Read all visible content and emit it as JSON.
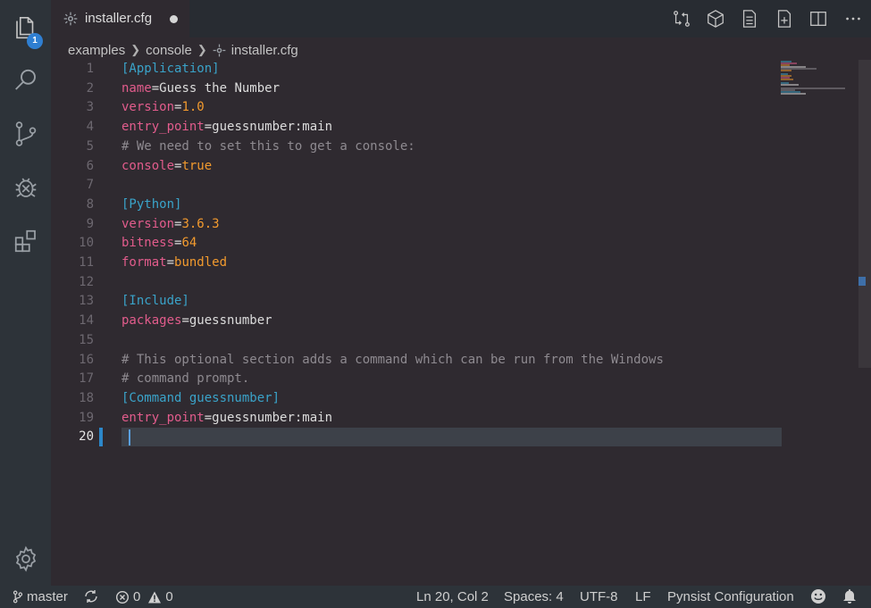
{
  "activity_bar": {
    "explorer_badge": "1"
  },
  "tab": {
    "filename": "installer.cfg"
  },
  "breadcrumb": {
    "items": [
      "examples",
      "console",
      "installer.cfg"
    ]
  },
  "editor": {
    "lines": [
      {
        "n": "1",
        "parts": [
          [
            "sec",
            "[Application]"
          ]
        ]
      },
      {
        "n": "2",
        "parts": [
          [
            "key",
            "name"
          ],
          [
            "eq",
            "="
          ],
          [
            "str",
            "Guess the Number"
          ]
        ]
      },
      {
        "n": "3",
        "parts": [
          [
            "key",
            "version"
          ],
          [
            "eq",
            "="
          ],
          [
            "num",
            "1.0"
          ]
        ]
      },
      {
        "n": "4",
        "parts": [
          [
            "key",
            "entry_point"
          ],
          [
            "eq",
            "="
          ],
          [
            "str",
            "guessnumber:main"
          ]
        ]
      },
      {
        "n": "5",
        "parts": [
          [
            "com",
            "# We need to set this to get a console:"
          ]
        ]
      },
      {
        "n": "6",
        "parts": [
          [
            "key",
            "console"
          ],
          [
            "eq",
            "="
          ],
          [
            "num",
            "true"
          ]
        ]
      },
      {
        "n": "7",
        "parts": []
      },
      {
        "n": "8",
        "parts": [
          [
            "sec",
            "[Python]"
          ]
        ]
      },
      {
        "n": "9",
        "parts": [
          [
            "key",
            "version"
          ],
          [
            "eq",
            "="
          ],
          [
            "num",
            "3.6.3"
          ]
        ]
      },
      {
        "n": "10",
        "parts": [
          [
            "key",
            "bitness"
          ],
          [
            "eq",
            "="
          ],
          [
            "num",
            "64"
          ]
        ]
      },
      {
        "n": "11",
        "parts": [
          [
            "key",
            "format"
          ],
          [
            "eq",
            "="
          ],
          [
            "num",
            "bundled"
          ]
        ]
      },
      {
        "n": "12",
        "parts": []
      },
      {
        "n": "13",
        "parts": [
          [
            "sec",
            "[Include]"
          ]
        ]
      },
      {
        "n": "14",
        "parts": [
          [
            "key",
            "packages"
          ],
          [
            "eq",
            "="
          ],
          [
            "str",
            "guessnumber"
          ]
        ]
      },
      {
        "n": "15",
        "parts": []
      },
      {
        "n": "16",
        "parts": [
          [
            "com",
            "# This optional section adds a command which can be run from the Windows"
          ]
        ]
      },
      {
        "n": "17",
        "parts": [
          [
            "com",
            "# command prompt."
          ]
        ]
      },
      {
        "n": "18",
        "parts": [
          [
            "sec",
            "[Command guessnumber]"
          ]
        ]
      },
      {
        "n": "19",
        "parts": [
          [
            "key",
            "entry_point"
          ],
          [
            "eq",
            "="
          ],
          [
            "str",
            "guessnumber:main"
          ]
        ]
      },
      {
        "n": "20",
        "parts": []
      }
    ],
    "active_line": "20"
  },
  "status_bar": {
    "branch": "master",
    "errors": "0",
    "warnings": "0",
    "position": "Ln 20, Col 2",
    "spaces": "Spaces: 4",
    "encoding": "UTF-8",
    "eol": "LF",
    "language": "Pynsist Configuration"
  },
  "colors": {
    "section": "#3aa3c9",
    "key": "#e25c8c",
    "number": "#f29a2e",
    "comment": "#8e8a90",
    "badge": "#2f7fd1"
  }
}
